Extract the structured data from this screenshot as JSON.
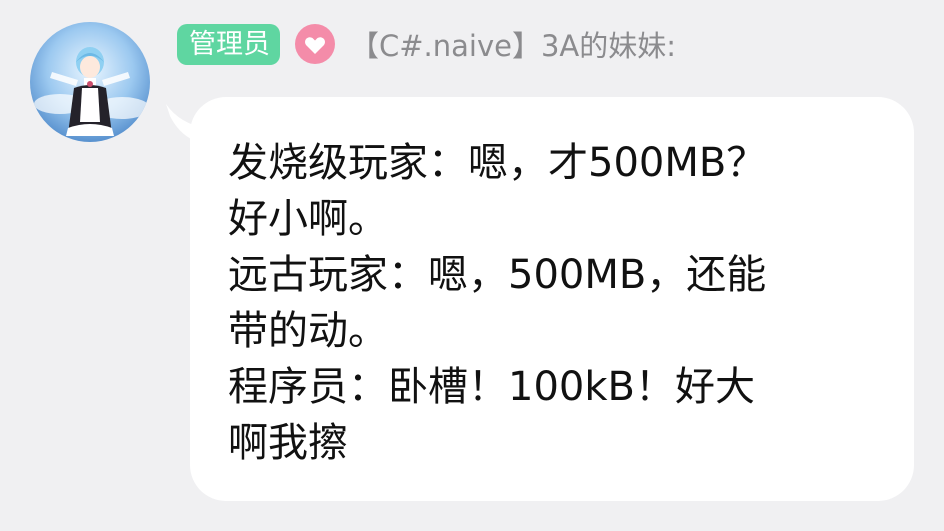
{
  "sender": {
    "role_badge": "管理员",
    "level_icon": "heart-shield-icon",
    "name": "【C#.naive】3A的妹妹:"
  },
  "message": {
    "lines": [
      "发烧级玩家：嗯，才500MB？",
      "好小啊。",
      "远古玩家：嗯，500MB，还能",
      "带的动。",
      "程序员：卧槽！100kB！好大",
      "啊我擦"
    ]
  },
  "colors": {
    "background": "#f0f0f2",
    "bubble": "#ffffff",
    "role_badge": "#5fd6a1",
    "level_icon": "#f48ca9",
    "sender_name": "#8b8b8e",
    "message_text": "#111111"
  }
}
